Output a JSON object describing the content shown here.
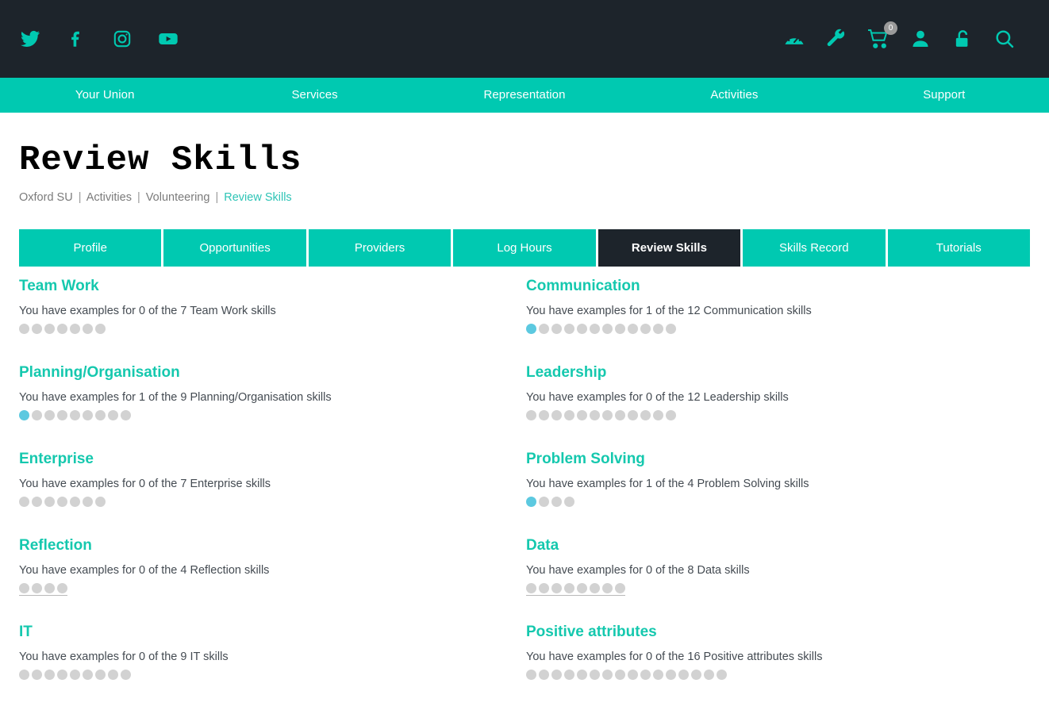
{
  "colors": {
    "dark": "#1d242b",
    "teal": "#00c9b1",
    "heading_teal": "#15c8ae",
    "dot_filled": "#5cc9e0",
    "dot_empty": "#d2d2d2"
  },
  "topbar": {
    "social": [
      {
        "name": "twitter-icon",
        "label": "Twitter"
      },
      {
        "name": "facebook-icon",
        "label": "Facebook"
      },
      {
        "name": "instagram-icon",
        "label": "Instagram"
      },
      {
        "name": "youtube-icon",
        "label": "YouTube"
      }
    ],
    "utilities": [
      {
        "name": "dashboard-icon",
        "label": "Dashboard"
      },
      {
        "name": "wrench-icon",
        "label": "Admin tools"
      },
      {
        "name": "cart-icon",
        "label": "Basket",
        "badge": "0"
      },
      {
        "name": "account-icon",
        "label": "Account"
      },
      {
        "name": "unlock-icon",
        "label": "Log in"
      },
      {
        "name": "search-icon",
        "label": "Search"
      }
    ]
  },
  "mainnav": {
    "items": [
      {
        "label": "Your Union"
      },
      {
        "label": "Services"
      },
      {
        "label": "Representation"
      },
      {
        "label": "Activities"
      },
      {
        "label": "Support"
      }
    ]
  },
  "header": {
    "title": "Review Skills"
  },
  "breadcrumb": {
    "items": [
      {
        "label": "Oxford SU",
        "current": false
      },
      {
        "label": "Activities",
        "current": false
      },
      {
        "label": "Volunteering",
        "current": false
      },
      {
        "label": "Review Skills",
        "current": true
      }
    ],
    "separator": "|"
  },
  "tabs": [
    {
      "label": "Profile",
      "active": false
    },
    {
      "label": "Opportunities",
      "active": false
    },
    {
      "label": "Providers",
      "active": false
    },
    {
      "label": "Log Hours",
      "active": false
    },
    {
      "label": "Review Skills",
      "active": true
    },
    {
      "label": "Skills Record",
      "active": false
    },
    {
      "label": "Tutorials",
      "active": false
    }
  ],
  "skills": [
    {
      "name": "Team Work",
      "description": "You have examples for 0 of the 7 Team Work skills",
      "completed": 0,
      "total": 7,
      "underlined": false
    },
    {
      "name": "Communication",
      "description": "You have examples for 1 of the 12 Communication skills",
      "completed": 1,
      "total": 12,
      "underlined": false
    },
    {
      "name": "Planning/Organisation",
      "description": "You have examples for 1 of the 9 Planning/Organisation skills",
      "completed": 1,
      "total": 9,
      "underlined": false
    },
    {
      "name": "Leadership",
      "description": "You have examples for 0 of the 12 Leadership skills",
      "completed": 0,
      "total": 12,
      "underlined": false
    },
    {
      "name": "Enterprise",
      "description": "You have examples for 0 of the 7 Enterprise skills",
      "completed": 0,
      "total": 7,
      "underlined": false
    },
    {
      "name": "Problem Solving",
      "description": "You have examples for 1 of the 4 Problem Solving skills",
      "completed": 1,
      "total": 4,
      "underlined": false
    },
    {
      "name": "Reflection",
      "description": "You have examples for 0 of the 4 Reflection skills",
      "completed": 0,
      "total": 4,
      "underlined": true
    },
    {
      "name": "Data",
      "description": "You have examples for 0 of the 8 Data skills",
      "completed": 0,
      "total": 8,
      "underlined": true
    },
    {
      "name": "IT",
      "description": "You have examples for 0 of the 9 IT skills",
      "completed": 0,
      "total": 9,
      "underlined": false
    },
    {
      "name": "Positive attributes",
      "description": "You have examples for 0 of the 16 Positive attributes skills",
      "completed": 0,
      "total": 16,
      "underlined": false
    }
  ]
}
